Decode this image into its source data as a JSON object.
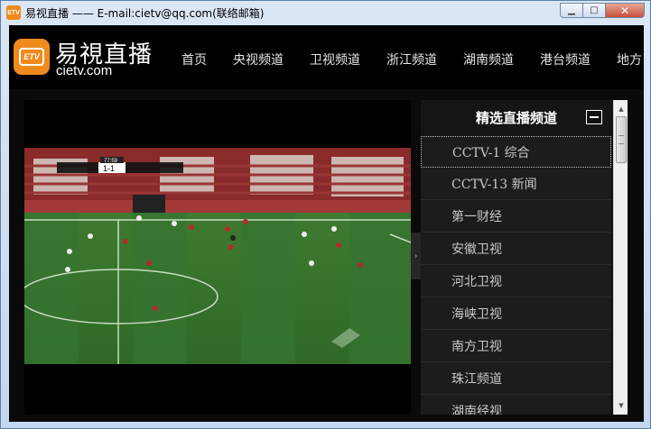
{
  "window": {
    "title": "易视直播 —— E-mail:cietv@qq.com(联络邮箱)",
    "app_icon_text": "ETV",
    "controls": {
      "minimize": "▁",
      "maximize": "□",
      "close": "✕"
    }
  },
  "header": {
    "logo_icon_text": "ETV",
    "logo_name": "易視直播",
    "logo_url": "cietv.com",
    "nav": [
      "首页",
      "央视频道",
      "卫视频道",
      "浙江频道",
      "湖南频道",
      "港台频道",
      "地方"
    ]
  },
  "player": {
    "scoreboard": {
      "score": "1-1",
      "time": "77:59"
    },
    "collapse_arrow": "›"
  },
  "panel": {
    "title": "精选直播频道",
    "channels": [
      "CCTV-1 综合",
      "CCTV-13 新闻",
      "第一财经",
      "安徽卫视",
      "河北卫视",
      "海峡卫视",
      "南方卫视",
      "珠江频道",
      "湖南经视"
    ],
    "selected_index": 0
  },
  "scrollbar": {
    "up": "▲",
    "down": "▼"
  },
  "colors": {
    "accent": "#f08a1d",
    "header_bg": "#000000",
    "panel_bg": "#151515"
  }
}
